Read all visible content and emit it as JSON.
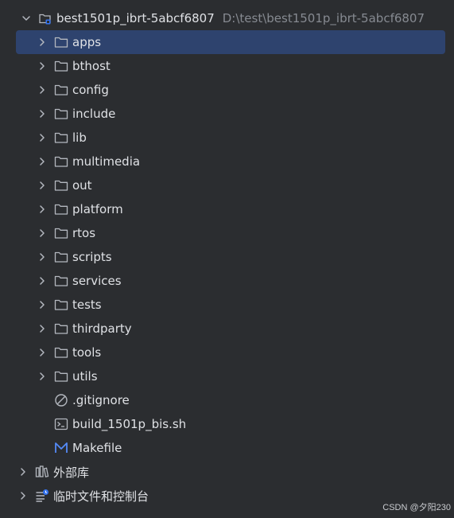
{
  "project": {
    "name": "best1501p_ibrt-5abcf6807",
    "path": "D:\\test\\best1501p_ibrt-5abcf6807"
  },
  "folders": [
    {
      "label": "apps",
      "selected": true
    },
    {
      "label": "bthost"
    },
    {
      "label": "config"
    },
    {
      "label": "include"
    },
    {
      "label": "lib"
    },
    {
      "label": "multimedia"
    },
    {
      "label": "out"
    },
    {
      "label": "platform"
    },
    {
      "label": "rtos"
    },
    {
      "label": "scripts"
    },
    {
      "label": "services"
    },
    {
      "label": "tests"
    },
    {
      "label": "thirdparty"
    },
    {
      "label": "tools"
    },
    {
      "label": "utils"
    }
  ],
  "files": [
    {
      "label": ".gitignore",
      "icon": "ignore-file-icon"
    },
    {
      "label": "build_1501p_bis.sh",
      "icon": "shell-script-icon"
    },
    {
      "label": "Makefile",
      "icon": "makefile-icon"
    }
  ],
  "roots": [
    {
      "label": "外部库",
      "icon": "external-libraries-icon"
    },
    {
      "label": "临时文件和控制台",
      "icon": "scratches-consoles-icon"
    }
  ],
  "watermark": "CSDN @夕阳230",
  "colors": {
    "background": "#2b2d30",
    "selection": "#2e436e",
    "text": "#dfe1e5",
    "muted": "#868a91",
    "accent": "#3574f0"
  }
}
